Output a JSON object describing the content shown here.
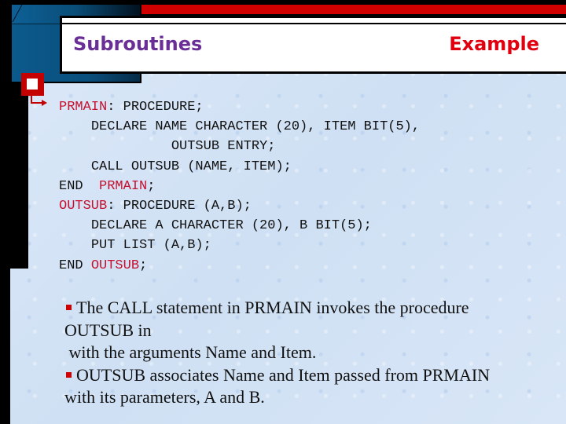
{
  "slide": {
    "title_left": "Subroutines",
    "title_right": "Example",
    "colors": {
      "title_left": "#6a2f96",
      "title_right": "#e00010",
      "accent_red": "#d10000",
      "label_red": "#c8102e",
      "background": "#d6e5f6"
    },
    "code": {
      "lines": [
        {
          "indent": "",
          "label": "PRMAIN",
          "text": ": PROCEDURE;"
        },
        {
          "indent": "    ",
          "label": "",
          "text": "DECLARE NAME CHARACTER (20), ITEM BIT(5),"
        },
        {
          "indent": "              ",
          "label": "",
          "text": "OUTSUB ENTRY;"
        },
        {
          "indent": "    ",
          "label": "",
          "text": "CALL OUTSUB (NAME, ITEM);"
        },
        {
          "indent": "",
          "label": "",
          "text": "END  ",
          "trail_label": "PRMAIN",
          "trail": ";"
        },
        {
          "indent": "",
          "label": "OUTSUB",
          "text": ": PROCEDURE (A,B);"
        },
        {
          "indent": "    ",
          "label": "",
          "text": "DECLARE A CHARACTER (20), B BIT(5);"
        },
        {
          "indent": "    ",
          "label": "",
          "text": "PUT LIST (A,B);"
        },
        {
          "indent": "",
          "label": "",
          "text": "END ",
          "trail_label": "OUTSUB",
          "trail": ";"
        }
      ]
    },
    "description": {
      "lines": [
        {
          "bullet": true,
          "text": "The CALL statement in PRMAIN invokes the procedure"
        },
        {
          "bullet": false,
          "text": "OUTSUB in"
        },
        {
          "bullet": false,
          "text": " with the arguments Name and Item."
        },
        {
          "bullet": true,
          "text": "OUTSUB associates Name and Item passed from PRMAIN"
        },
        {
          "bullet": false,
          "text": "with its parameters, A and B."
        }
      ]
    }
  }
}
